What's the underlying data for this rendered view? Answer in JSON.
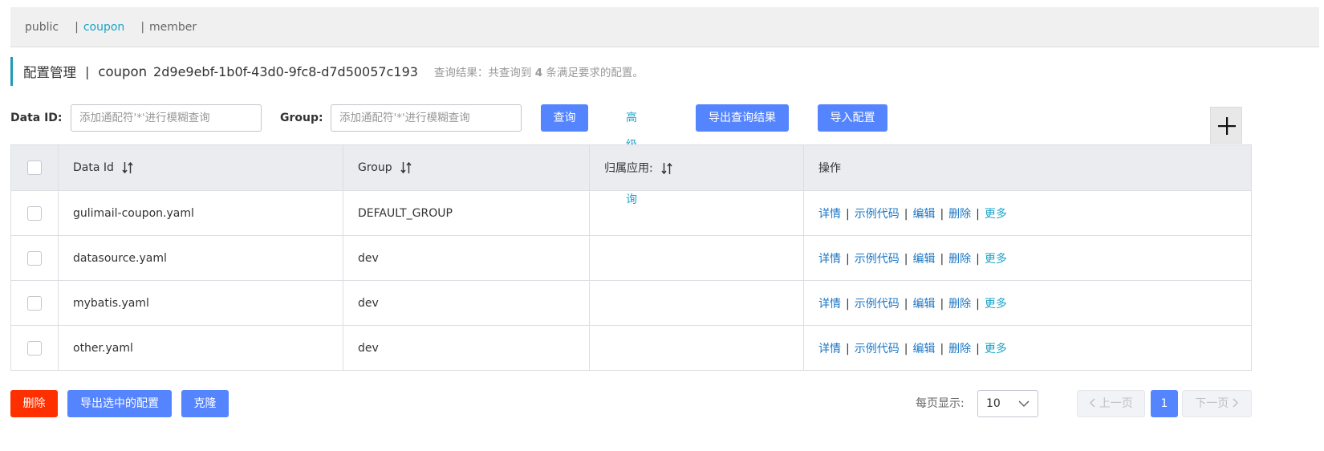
{
  "namespaces": [
    {
      "label": "public",
      "active": false
    },
    {
      "label": "coupon",
      "active": true
    },
    {
      "label": "member",
      "active": false
    }
  ],
  "ns_separator": "|",
  "header": {
    "title": "配置管理",
    "divider": "|",
    "namespace_name": "coupon",
    "namespace_id": "2d9e9ebf-1b0f-43d0-9fc8-d7d50057c193",
    "result_prefix": "查询结果：共查询到",
    "result_count": "4",
    "result_suffix": "条满足要求的配置。"
  },
  "search": {
    "data_id_label": "Data ID:",
    "data_id_placeholder": "添加通配符'*'进行模糊查询",
    "group_label": "Group:",
    "group_placeholder": "添加通配符'*'进行模糊查询",
    "query_button": "查询",
    "advanced_query": "高级查询",
    "export_results_button": "导出查询结果",
    "import_button": "导入配置"
  },
  "table": {
    "headers": {
      "data_id": "Data Id",
      "group": "Group",
      "app": "归属应用:",
      "ops": "操作"
    },
    "rows": [
      {
        "data_id": "gulimail-coupon.yaml",
        "group": "DEFAULT_GROUP",
        "app": ""
      },
      {
        "data_id": "datasource.yaml",
        "group": "dev",
        "app": ""
      },
      {
        "data_id": "mybatis.yaml",
        "group": "dev",
        "app": ""
      },
      {
        "data_id": "other.yaml",
        "group": "dev",
        "app": ""
      }
    ],
    "ops": {
      "detail": "详情",
      "sample_code": "示例代码",
      "edit": "编辑",
      "delete": "删除",
      "more": "更多",
      "separator": "|"
    }
  },
  "footer": {
    "delete_button": "删除",
    "export_selected_button": "导出选中的配置",
    "clone_button": "克隆",
    "page_size_label": "每页显示:",
    "page_size_value": "10",
    "prev_page": "上一页",
    "current_page": "1",
    "next_page": "下一页"
  },
  "colors": {
    "primary": "#5584ff",
    "danger": "#ff3000",
    "link": "#1b76c4",
    "accent_link": "#1ca3c7",
    "title_bar": "#1b9bb6"
  },
  "icons": {
    "add": "plus-icon",
    "sort": "sort-icon",
    "dropdown": "chevron-down-icon",
    "prev": "chevron-left-icon",
    "next": "chevron-right-icon"
  }
}
